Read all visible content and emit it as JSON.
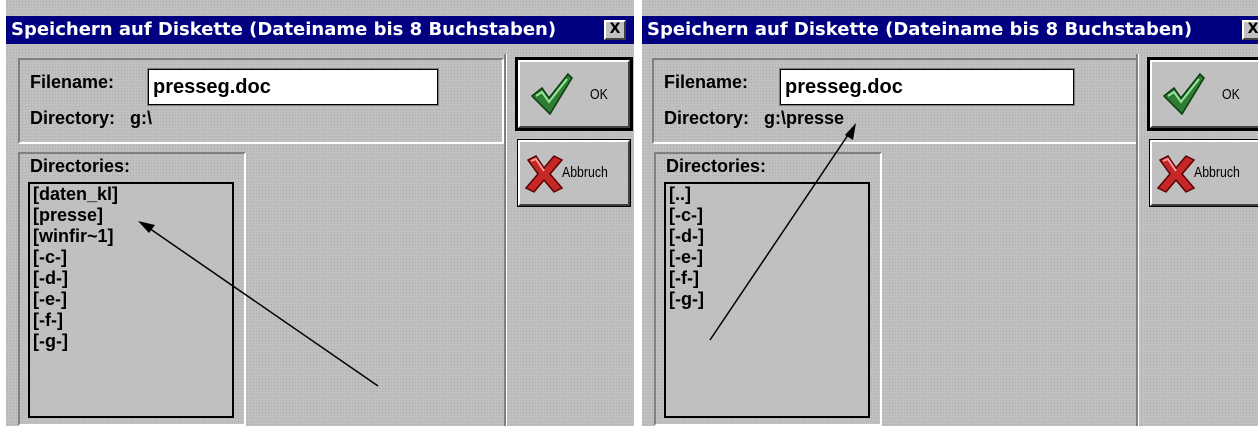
{
  "dialogs": [
    {
      "title": "Speichern auf Diskette (Dateiname bis 8 Buchstaben)",
      "close_label": "X",
      "filename_label": "Filename:",
      "filename_value": "presseg.doc",
      "directory_label": "Directory:",
      "directory_value": "g:\\",
      "directories_label": "Directories:",
      "directories": [
        "[daten_kl]",
        "[presse]",
        "[winfir~1]",
        "[-c-]",
        "[-d-]",
        "[-e-]",
        "[-f-]",
        "[-g-]"
      ],
      "ok_label": "OK",
      "cancel_label": "Abbruch"
    },
    {
      "title": "Speichern auf Diskette (Dateiname bis 8 Buchstaben)",
      "close_label": "X",
      "filename_label": "Filename:",
      "filename_value": "presseg.doc",
      "directory_label": "Directory:",
      "directory_value": "g:\\presse",
      "directories_label": "Directories:",
      "directories": [
        "[..]",
        "[-c-]",
        "[-d-]",
        "[-e-]",
        "[-f-]",
        "[-g-]"
      ],
      "ok_label": "OK",
      "cancel_label": "Abbruch"
    }
  ],
  "colors": {
    "titlebar": "#000080",
    "title_text": "#ffffff",
    "dialog_face": "#c0c0c0",
    "checkmark": "#2e7d32",
    "cross": "#c62828"
  },
  "icons": [
    "checkmark-icon",
    "red-x-icon",
    "arrow-annotation"
  ]
}
